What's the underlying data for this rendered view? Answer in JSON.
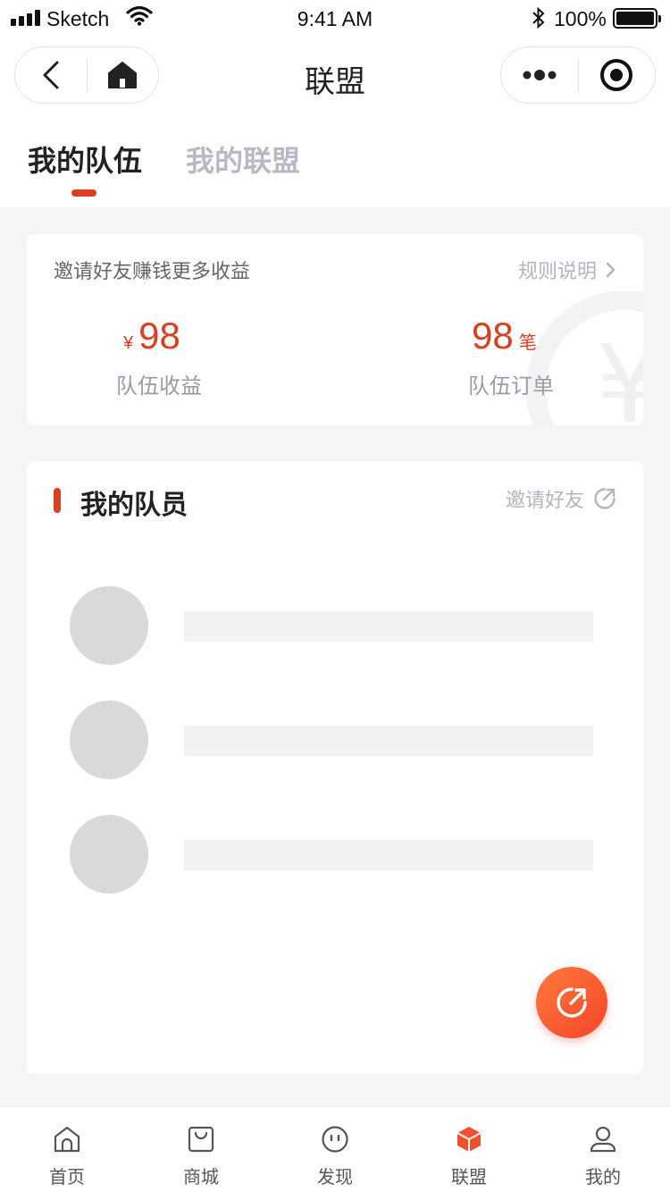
{
  "status_bar": {
    "carrier": "Sketch",
    "time": "9:41 AM",
    "battery": "100%"
  },
  "nav": {
    "title": "联盟"
  },
  "tabs": [
    {
      "label": "我的队伍",
      "active": true
    },
    {
      "label": "我的联盟",
      "active": false
    }
  ],
  "earnings": {
    "title": "邀请好友赚钱更多收益",
    "rules_link": "规则说明",
    "team_income": {
      "currency": "¥",
      "value": "98",
      "label": "队伍收益"
    },
    "team_orders": {
      "value": "98",
      "unit": "笔",
      "label": "队伍订单"
    },
    "watermark_symbol": "¥"
  },
  "members": {
    "title": "我的队员",
    "invite_link": "邀请好友"
  },
  "tabbar": {
    "items": [
      {
        "label": "首页",
        "icon": "home-icon",
        "active": false
      },
      {
        "label": "商城",
        "icon": "shopping-bag-icon",
        "active": false
      },
      {
        "label": "发现",
        "icon": "discover-face-icon",
        "active": false
      },
      {
        "label": "联盟",
        "icon": "alliance-cube-icon",
        "active": true
      },
      {
        "label": "我的",
        "icon": "profile-icon",
        "active": false
      }
    ]
  },
  "colors": {
    "accent": "#d9401f",
    "muted": "#b8b8c6",
    "background": "#f5f5f5"
  }
}
